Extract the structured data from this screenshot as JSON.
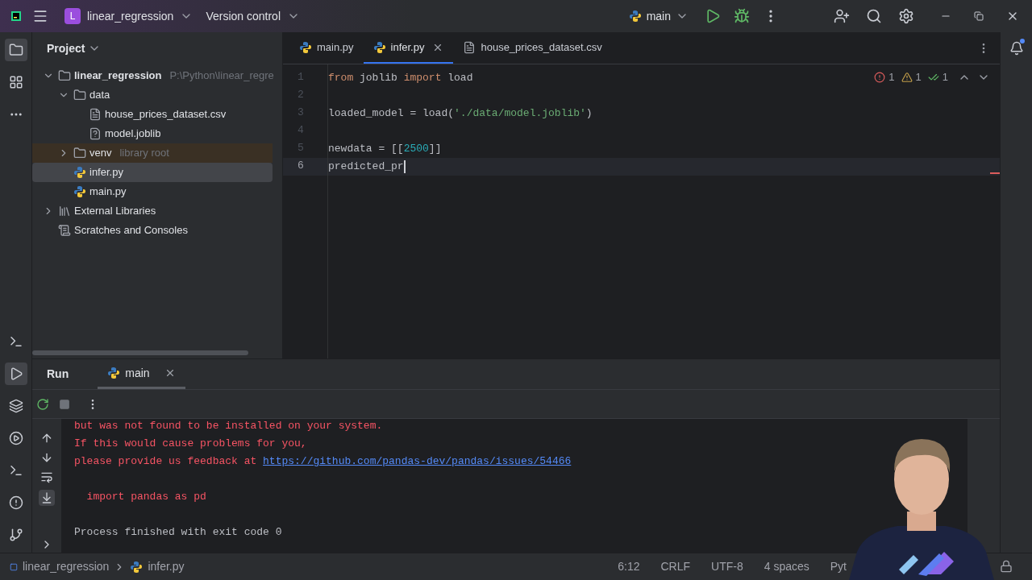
{
  "title_bar": {
    "project_initial": "L",
    "project": "linear_regression",
    "vcs": "Version control",
    "run_config": "main"
  },
  "project_panel": {
    "title": "Project",
    "tree": [
      {
        "label": "linear_regression",
        "kind": "folder",
        "hint": "P:\\Python\\linear_regre",
        "expanded": true,
        "selected": false,
        "children": [
          {
            "label": "data",
            "kind": "folder",
            "expanded": true,
            "selected": false,
            "children": [
              {
                "label": "house_prices_dataset.csv",
                "kind": "text",
                "selected": false
              },
              {
                "label": "model.joblib",
                "kind": "unknown",
                "selected": false
              }
            ]
          },
          {
            "label": "venv",
            "kind": "folder",
            "hint": "library root",
            "library": true,
            "expanded": false,
            "selected": false
          },
          {
            "label": "infer.py",
            "kind": "python",
            "selected": true
          },
          {
            "label": "main.py",
            "kind": "python",
            "selected": false
          }
        ]
      },
      {
        "label": "External Libraries",
        "kind": "libraries",
        "expanded": false,
        "selected": false
      },
      {
        "label": "Scratches and Consoles",
        "kind": "scratches",
        "selected": false
      }
    ]
  },
  "editor": {
    "tabs": [
      {
        "label": "main.py",
        "kind": "python",
        "selected": false
      },
      {
        "label": "infer.py",
        "kind": "python",
        "selected": true
      },
      {
        "label": "house_prices_dataset.csv",
        "kind": "text",
        "selected": false
      }
    ],
    "inspections": {
      "errors": "1",
      "warnings": "1",
      "ok": "1"
    },
    "lines": [
      {
        "number": "1",
        "current": false,
        "tokens": [
          {
            "kind": "keyword",
            "text": "from"
          },
          {
            "kind": "plain",
            "text": " joblib "
          },
          {
            "kind": "keyword",
            "text": "import"
          },
          {
            "kind": "plain",
            "text": " load"
          }
        ]
      },
      {
        "number": "2",
        "current": false
      },
      {
        "number": "3",
        "current": false,
        "tokens": [
          {
            "kind": "plain",
            "text": "loaded_model = load("
          },
          {
            "kind": "string",
            "text": "'./data/model.joblib'"
          },
          {
            "kind": "plain",
            "text": ")"
          }
        ]
      },
      {
        "number": "4",
        "current": false
      },
      {
        "number": "5",
        "current": false,
        "tokens": [
          {
            "kind": "plain",
            "text": "newdata = [["
          },
          {
            "kind": "number",
            "text": "2500"
          },
          {
            "kind": "plain",
            "text": "]]"
          }
        ]
      },
      {
        "number": "6",
        "current": true,
        "tokens": [
          {
            "kind": "plain",
            "text": "predicted_pr"
          }
        ]
      }
    ]
  },
  "run_panel": {
    "title": "Run",
    "tabs": [
      {
        "label": "main",
        "selected": true
      }
    ],
    "output": [
      {
        "kind": "error",
        "text": "but was not found to be installed on your system."
      },
      {
        "kind": "error",
        "text": "If this would cause problems for you,"
      },
      {
        "kind": "error",
        "text": "please provide us feedback at ",
        "link": "https://github.com/pandas-dev/pandas/issues/54466"
      },
      {
        "kind": "blank"
      },
      {
        "kind": "error",
        "text": "  import pandas as pd"
      },
      {
        "kind": "blank"
      },
      {
        "kind": "normal",
        "text": "Process finished with exit code 0"
      }
    ]
  },
  "status_bar": {
    "breadcrumbs": [
      "linear_regression",
      "infer.py"
    ],
    "items": [
      "6:12",
      "CRLF",
      "UTF-8",
      "4 spaces",
      "Pyt"
    ]
  }
}
